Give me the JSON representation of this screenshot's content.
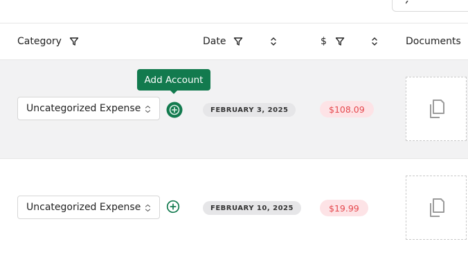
{
  "table": {
    "columns": {
      "category": "Category",
      "date": "Date",
      "amount": "$",
      "documents": "Documents"
    },
    "rows": [
      {
        "category": "Uncategorized Expense",
        "date": "FEBRUARY 3, 2025",
        "amount": "$108.09"
      },
      {
        "category": "Uncategorized Expense",
        "date": "FEBRUARY 10, 2025",
        "amount": "$19.99"
      }
    ]
  },
  "tooltip": {
    "text": "Add Account"
  },
  "colors": {
    "accent_green": "#127a4e",
    "amount_text": "#e5484d",
    "amount_bg": "#fde3e6"
  },
  "icons": {
    "filter": "filter-icon",
    "sort": "sort-icon",
    "add": "plus-circle-icon",
    "document": "copy-document-icon",
    "chevron": "select-chevron-icon"
  }
}
